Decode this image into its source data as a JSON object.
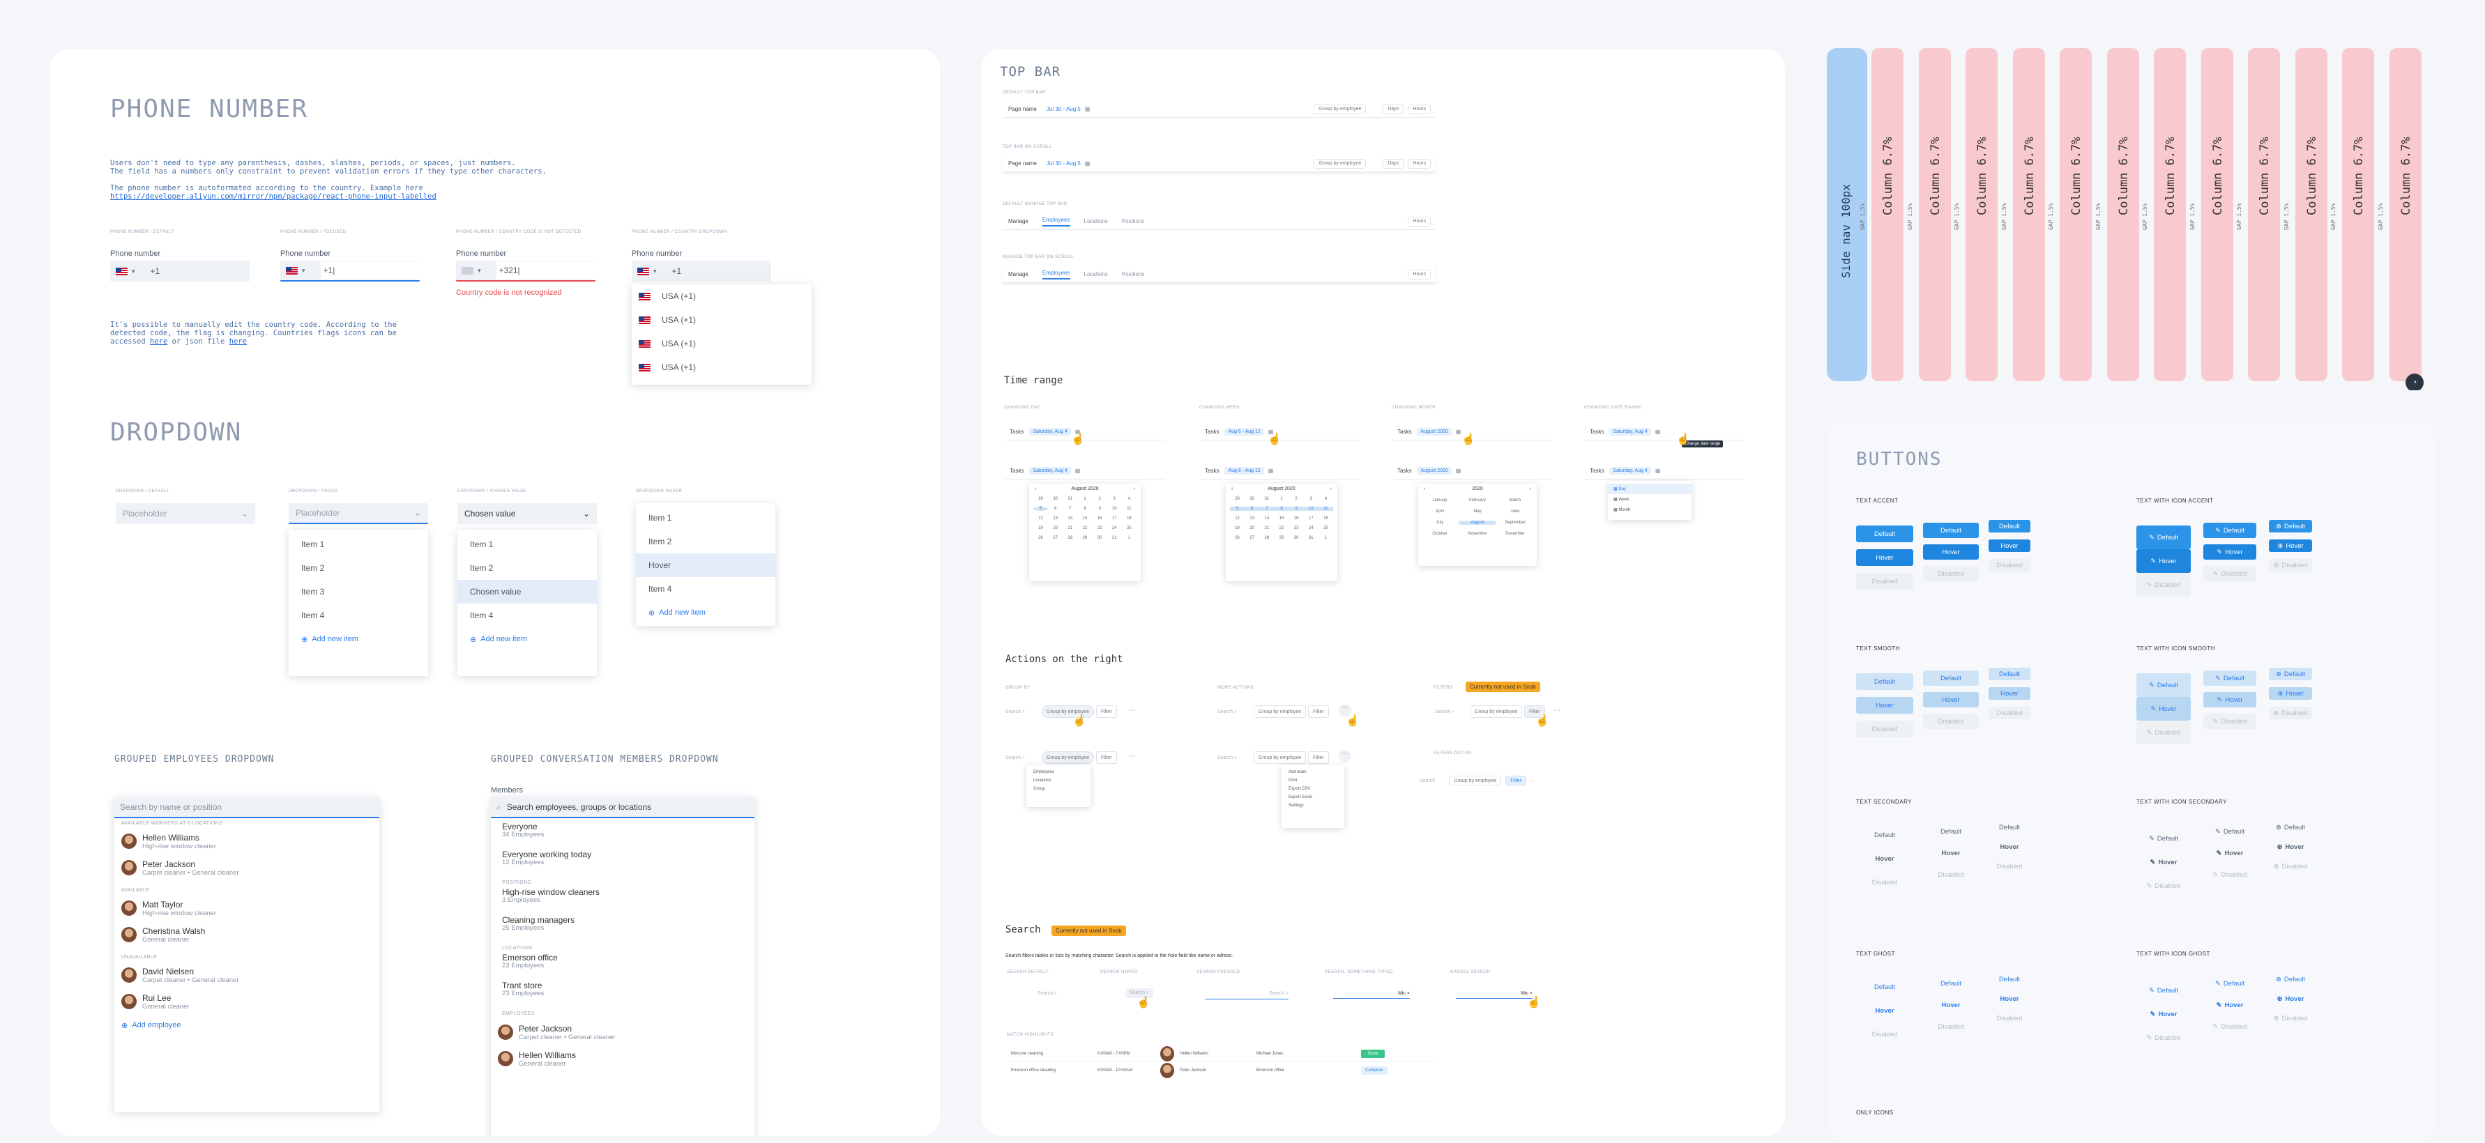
{
  "phone": {
    "title": "PHONE NUMBER",
    "desc": "Users don't need to type any parenthesis, dashes, slashes, periods, or spaces, just numbers.\nThe field has a numbers only constraint to prevent validation errors if they type other characters.\n\nThe phone number is autoformated according to the country. Example here",
    "link": "https://developer.aliyun.com/mirror/npm/package/react-phone-input-labelled",
    "states": [
      {
        "caption": "PHONE NUMBER / DEFAULT",
        "label": "Phone number",
        "value": "+1"
      },
      {
        "caption": "PHONE NUMBER / FOCUSED",
        "label": "Phone number",
        "value": "+1|"
      },
      {
        "caption": "PHONE NUMBER / COUNTRY CODE IS NOT DETECTED",
        "label": "Phone number",
        "value": "+321|",
        "error": "Country code is not recognized"
      },
      {
        "caption": "PHONE NUMBER / COUNTRY DROPDOWN",
        "label": "Phone number",
        "value": "+1"
      }
    ],
    "countries": [
      "USA (+1)",
      "USA (+1)",
      "USA (+1)",
      "USA (+1)"
    ],
    "note2a": "It's possible to manually edit the country code. According to the\ndetected code, the flag is changing. Countries flags icons can be\naccessed ",
    "note2_here1": "here",
    "note2_mid": " or json file ",
    "note2_here2": "here"
  },
  "dropdown": {
    "title": "DROPDOWN",
    "states": [
      {
        "caption": "DROPDOWN / DEFAULT",
        "value": "Placeholder"
      },
      {
        "caption": "DROPDOWN / FOCUS",
        "value": "Placeholder"
      },
      {
        "caption": "DROPDOWN / CHOSEN VALUE",
        "value": "Chosen value"
      },
      {
        "caption": "DROPDOWN HOVER"
      }
    ],
    "focus_items": [
      "Item 1",
      "Item 2",
      "Item 3",
      "Item 4"
    ],
    "chosen_items": [
      "Item 1",
      "Item 2",
      "Chosen value",
      "Item 4"
    ],
    "hover_items": [
      "Item 1",
      "Item 2",
      "Hover",
      "Item 4"
    ],
    "add_new": "Add new item"
  },
  "grouped_emp": {
    "title": "GROUPED EMPLOYEES DROPDOWN",
    "placeholder": "Search by name or position",
    "groups": [
      {
        "name": "AVAILABLE WORKERS AT 6 LOCATIONS",
        "people": [
          {
            "name": "Hellen Williams",
            "role": "High-rise window cleaner"
          },
          {
            "name": "Peter Jackson",
            "role": "Carpet cleaner • General cleaner"
          }
        ]
      },
      {
        "name": "AVAILABLE",
        "people": [
          {
            "name": "Matt Taylor",
            "role": "High-rise window cleaner"
          },
          {
            "name": "Cheristina Walsh",
            "role": "General cleaner"
          }
        ]
      },
      {
        "name": "UNAVAILABLE",
        "people": [
          {
            "name": "David Nielsen",
            "role": "Carpet cleaner • General cleaner"
          },
          {
            "name": "Rui Lee",
            "role": "General cleaner"
          }
        ]
      }
    ],
    "add": "Add employee"
  },
  "grouped_conv": {
    "title": "GROUPED CONVERSATION MEMBERS DROPDOWN",
    "label": "Members",
    "placeholder": "Search employees, groups or locations",
    "top": [
      {
        "name": "Everyone",
        "sub": "34 Employees"
      },
      {
        "name": "Everyone working today",
        "sub": "12 Employees"
      }
    ],
    "positions_label": "POSITIONS",
    "positions": [
      {
        "name": "High-rise window cleaners",
        "sub": "3 Employees"
      },
      {
        "name": "Cleaning managers",
        "sub": "25 Employees"
      }
    ],
    "locations_label": "LOCATIONS",
    "locations": [
      {
        "name": "Emerson office",
        "sub": "23 Employees"
      },
      {
        "name": "Trant store",
        "sub": "23 Employees"
      }
    ],
    "employees_label": "EMPLOYEES",
    "employees": [
      {
        "name": "Peter Jackson",
        "sub": "Carpet cleaner • General cleaner"
      },
      {
        "name": "Hellen Williams",
        "sub": "General cleaner"
      }
    ]
  },
  "topbar": {
    "title": "TOP BAR",
    "bars": [
      {
        "caption": "DEFAULT TOP BAR",
        "name": "Page name",
        "date": "Jul 30 - Aug 5"
      },
      {
        "caption": "TOP BAR ON SCROLL",
        "name": "Page name",
        "date": "Jul 30 - Aug 5"
      }
    ],
    "manage": [
      {
        "caption": "DEFAULT MANAGE TOP BAR",
        "name": "Manage",
        "tabs": [
          "Employees",
          "Locations",
          "Positions"
        ]
      },
      {
        "caption": "MANAGE TOP BAR ON SCROLL",
        "name": "Manage",
        "tabs": [
          "Employees",
          "Locations",
          "Positions"
        ]
      }
    ],
    "group_by": "Group by employee",
    "btn_a": "Days",
    "btn_b": "Hours"
  },
  "timerange": {
    "title": "Time range",
    "captions": [
      "CHANGING DAY",
      "CHANGING WEEK",
      "CHANGING MONTH",
      "CHANGING DATE RANGE"
    ],
    "chips": [
      "Saturday, Aug 4",
      "Aug 6 - Aug 12",
      "August 2020",
      "Saturday, Aug 4"
    ],
    "tasks": "Tasks",
    "month": "August 2020",
    "year": "2020",
    "months": [
      "January",
      "February",
      "March",
      "April",
      "May",
      "June",
      "July",
      "August",
      "September",
      "October",
      "November",
      "December"
    ],
    "range_opts": [
      "Day",
      "Week",
      "Month"
    ],
    "tooltip": "Change date range"
  },
  "actions": {
    "title": "Actions on the right",
    "captions": [
      "GROUP BY",
      "MORE ACTIONS",
      "FILTERS",
      "FILTERS ACTIVE"
    ],
    "badge": "Currently not used in Snob",
    "search": "Search",
    "group": "Group by employee",
    "filter": "Filter",
    "group_menu": [
      "Employees",
      "Locations",
      "Group"
    ],
    "more_menu": [
      "Add team",
      "Print",
      "Export CSV",
      "Export Excel",
      "Settings"
    ]
  },
  "search": {
    "title": "Search",
    "badge": "Currently not used in Snob",
    "desc": "Search filters tables or lists by matching character. Search is applied to the hole field like name or adress.",
    "captions": [
      "SEARCH DEFAULT",
      "SEARCH HOVER",
      "SEARCH PRESSED",
      "SEARCH, SOMETHING TYPED",
      "CANCEL SEARCH"
    ],
    "placeholder": "Search",
    "typed": "Mic",
    "match_caption": "MATCH HIGHLIGHTS",
    "rows": [
      {
        "a": "Mercure cleaning",
        "b": "8:00AM - 7:00PM",
        "c": "Hellen Williams",
        "d": "Michael Jones",
        "btn": "Done"
      },
      {
        "a": "Emerson office cleaning",
        "b": "8:00AM - 10:00AM",
        "c": "Peter Jackson",
        "d": "Emerson office",
        "btn": "Complete"
      }
    ]
  },
  "grid": {
    "side": "Side nav 100px",
    "column": "Column 6.7%",
    "gap": "GAP 1.5%"
  },
  "buttons": {
    "title": "BUTTONS",
    "sections": [
      {
        "title": "TEXT ACCENT"
      },
      {
        "title": "TEXT WITH ICON ACCENT"
      },
      {
        "title": "TEXT SMOOTH"
      },
      {
        "title": "TEXT WITH ICON SMOOTH"
      },
      {
        "title": "TEXT SECONDARY"
      },
      {
        "title": "TEXT WITH ICON SECONDARY"
      },
      {
        "title": "TEXT GHOST"
      },
      {
        "title": "TEXT WITH ICON GHOST"
      },
      {
        "title": "ONLY ICONS"
      }
    ],
    "default": "Default",
    "hover": "Hover",
    "disabled": "Disabled"
  },
  "colors": {
    "accent": "#2b93e8",
    "pink": "#f9c9d0",
    "blue": "#a9cff5",
    "warning": "#f5a623",
    "error": "#e5484d",
    "success": "#3cc48a"
  }
}
